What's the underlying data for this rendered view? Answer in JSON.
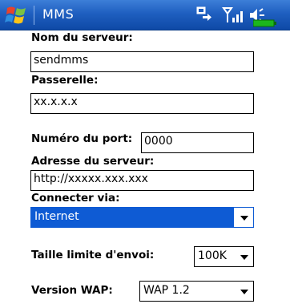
{
  "titlebar": {
    "title": "MMS",
    "icons": [
      "windows-start-icon",
      "connectivity-icon",
      "signal-icon",
      "volume-icon",
      "battery-icon"
    ]
  },
  "form": {
    "server_name": {
      "label": "Nom du serveur:",
      "value": "sendmms"
    },
    "gateway": {
      "label": "Passerelle:",
      "value": "xx.x.x.x"
    },
    "port": {
      "label": "Numéro du port:",
      "value": "0000"
    },
    "server_address": {
      "label": "Adresse du serveur:",
      "value": "http://xxxxx.xxx.xxx"
    },
    "connect_via": {
      "label": "Connecter via:",
      "selected": "Internet"
    },
    "send_limit": {
      "label": "Taille limite d'envoi:",
      "selected": "100K"
    },
    "wap_version": {
      "label": "Version WAP:",
      "selected": "WAP 1.2"
    }
  },
  "colors": {
    "titlebar": "#1f5fc0",
    "selection": "#0e5bd4"
  }
}
